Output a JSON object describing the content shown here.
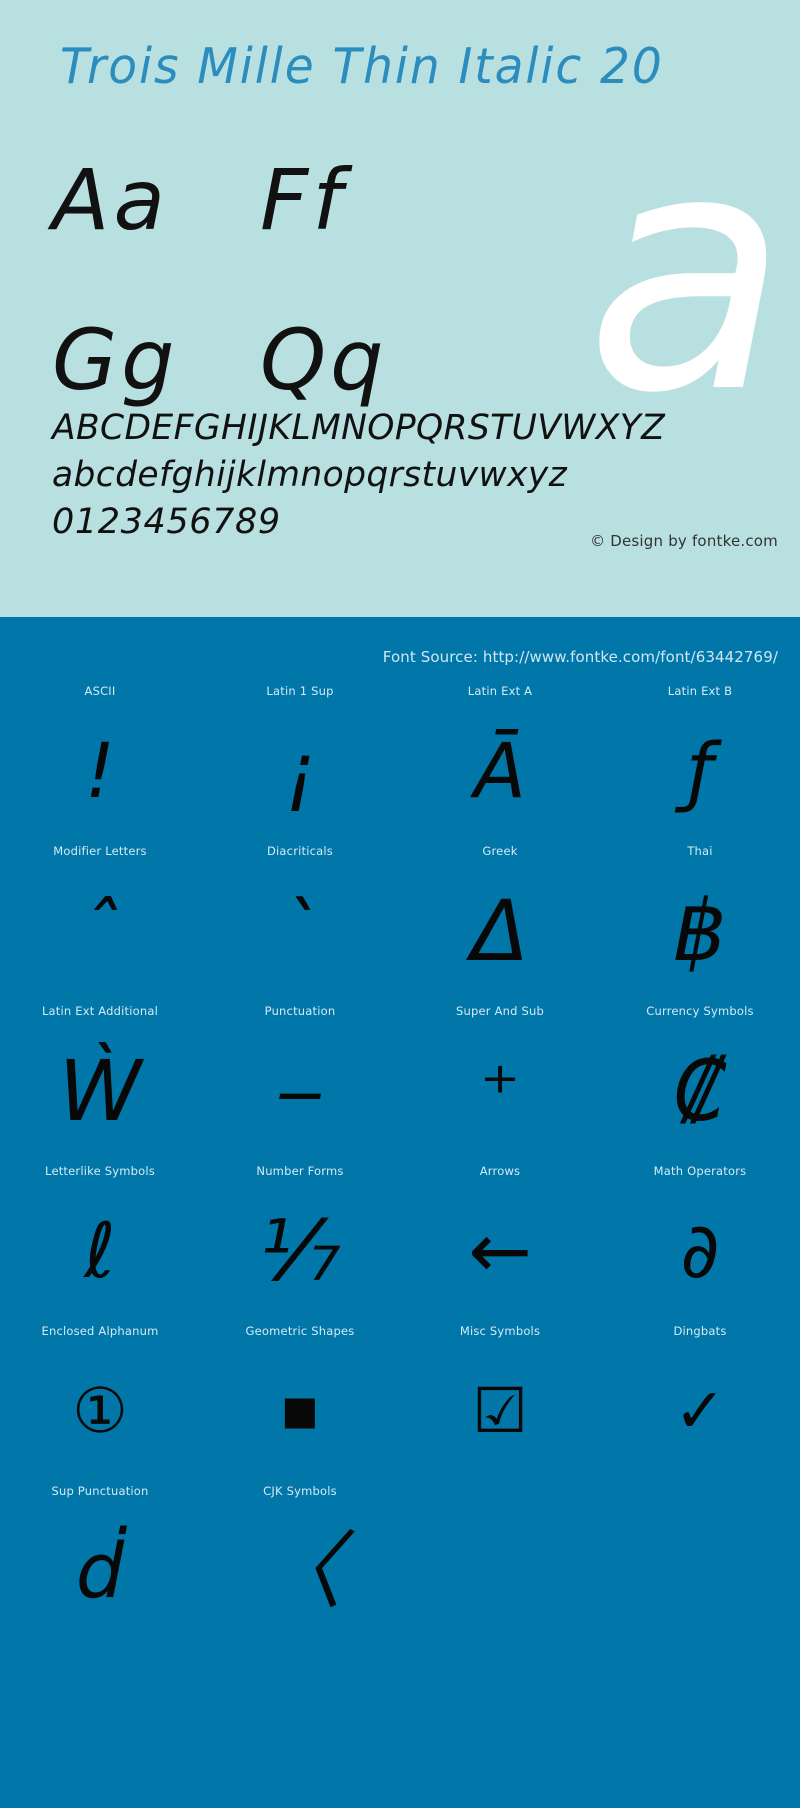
{
  "specimen": {
    "title": "Trois Mille Thin Italic 20",
    "title_color": "#2b8cbe",
    "background_color": "#b8e0e0",
    "hero_glyph": "a",
    "hero_glyph_color": "#ffffff",
    "pairs": [
      [
        "Aa",
        "Ff"
      ],
      [
        "Gg",
        "Qq"
      ]
    ],
    "alphabet_upper": "ABCDEFGHIJKLMNOPQRSTUVWXYZ",
    "alphabet_lower": "abcdefghijklmnopqrstuvwxyz",
    "digits": "0123456789",
    "copyright": "© Design by fontke.com"
  },
  "blocks_panel": {
    "background_color": "#0077a8",
    "font_source": "Font Source: http://www.fontke.com/font/63442769/",
    "rows": [
      [
        {
          "label": "ASCII",
          "glyph": "!"
        },
        {
          "label": "Latin 1 Sup",
          "glyph": "¡"
        },
        {
          "label": "Latin Ext A",
          "glyph": "Ā"
        },
        {
          "label": "Latin Ext B",
          "glyph": "ƒ"
        }
      ],
      [
        {
          "label": "Modifier Letters",
          "glyph": "ˆ"
        },
        {
          "label": "Diacriticals",
          "glyph": "ˋ"
        },
        {
          "label": "Greek",
          "glyph": "Δ"
        },
        {
          "label": "Thai",
          "glyph": "฿"
        }
      ],
      [
        {
          "label": "Latin Ext Additional",
          "glyph": "Ẁ"
        },
        {
          "label": "Punctuation",
          "glyph": "‒"
        },
        {
          "label": "Super And Sub",
          "glyph": "⁺"
        },
        {
          "label": "Currency Symbols",
          "glyph": "₡"
        }
      ],
      [
        {
          "label": "Letterlike Symbols",
          "glyph": "ℓ"
        },
        {
          "label": "Number Forms",
          "glyph": "⅐"
        },
        {
          "label": "Arrows",
          "glyph": "←"
        },
        {
          "label": "Math Operators",
          "glyph": "∂"
        }
      ],
      [
        {
          "label": "Enclosed Alphanum",
          "glyph": "①"
        },
        {
          "label": "Geometric Shapes",
          "glyph": "■"
        },
        {
          "label": "Misc Symbols",
          "glyph": "☑"
        },
        {
          "label": "Dingbats",
          "glyph": "✓"
        }
      ],
      [
        {
          "label": "Sup Punctuation",
          "glyph": "ḋ"
        },
        {
          "label": "CJK Symbols",
          "glyph": "〈"
        },
        {
          "label": "",
          "glyph": ""
        },
        {
          "label": "",
          "glyph": ""
        }
      ]
    ]
  }
}
